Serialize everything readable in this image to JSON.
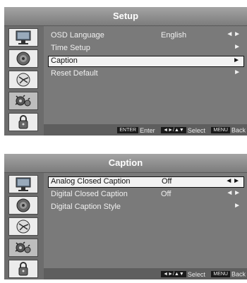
{
  "setup_menu": {
    "title": "Setup",
    "items": [
      {
        "label": "OSD Language",
        "value": "English",
        "arrows": "◄ ►"
      },
      {
        "label": "Time Setup",
        "value": "",
        "arrows": "►"
      },
      {
        "label": "Caption",
        "value": "",
        "arrows": "►"
      },
      {
        "label": "Reset Default",
        "value": "",
        "arrows": "►"
      }
    ],
    "selected_index": 2,
    "footer": {
      "enter_key": "ENTER",
      "enter_label": "Enter",
      "select_key": "◄►/▲▼",
      "select_label": "Select",
      "menu_key": "MENU",
      "back_label": "Back"
    }
  },
  "caption_menu": {
    "title": "Caption",
    "items": [
      {
        "label": "Analog Closed Caption",
        "value": "Off",
        "arrows": "◄ ►"
      },
      {
        "label": "Digital Closed Caption",
        "value": "Off",
        "arrows": "◄ ►"
      },
      {
        "label": "Digital Caption Style",
        "value": "",
        "arrows": "►"
      }
    ],
    "selected_index": 0,
    "footer": {
      "select_key": "◄►/▲▼",
      "select_label": "Select",
      "menu_key": "MENU",
      "back_label": "Back"
    }
  },
  "sidebar_icons": [
    "picture-icon",
    "sound-icon",
    "channel-icon",
    "setup-icon",
    "lock-icon"
  ],
  "colors": {
    "menu_bg": "#7a7a7a",
    "highlight": "#f2f2f2",
    "footer_bg": "#5e5e5e"
  }
}
